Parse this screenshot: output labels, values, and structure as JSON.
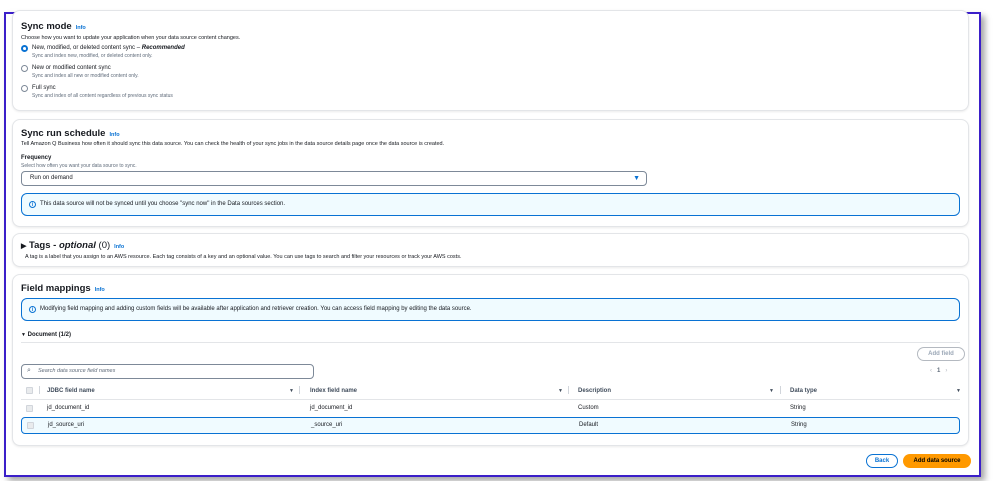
{
  "sync_mode": {
    "title": "Sync mode",
    "info": "Info",
    "description": "Choose how you want to update your application when your data source content changes.",
    "options": [
      {
        "label": "New, modified, or deleted content sync",
        "suffix": "Recommended",
        "description": "Sync and index new, modified, or deleted content only.",
        "selected": true
      },
      {
        "label": "New or modified content sync",
        "description": "Sync and index all new or modified content only.",
        "selected": false
      },
      {
        "label": "Full sync",
        "description": "Sync and index of all content regardless of previous sync status",
        "selected": false
      }
    ]
  },
  "schedule": {
    "title": "Sync run schedule",
    "info": "Info",
    "description": "Tell Amazon Q Business how often it should sync this data source. You can check the health of your sync jobs in the data source details page once the data source is created.",
    "frequency_label": "Frequency",
    "frequency_hint": "Select how often you want your data source to sync.",
    "frequency_value": "Run on demand",
    "alert": "This data source will not be synced until you choose \"sync now\" in the Data sources section."
  },
  "tags": {
    "title": "Tags -",
    "optional": "optional",
    "count": "(0)",
    "info": "Info",
    "description": "A tag is a label that you assign to an AWS resource. Each tag consists of a key and an optional value. You can use tags to search and filter your resources or track your AWS costs."
  },
  "field_mappings": {
    "title": "Field mappings",
    "info": "Info",
    "alert": "Modifying field mapping and adding custom fields will be available after application and retriever creation. You can access field mapping by editing the data source.",
    "section": "Document (1/2)",
    "add_field": "Add field",
    "search_placeholder": "Search data source field names",
    "page": "1",
    "columns": [
      "JDBC field name",
      "Index field name",
      "Description",
      "Data type"
    ],
    "rows": [
      [
        "jd_document_id",
        "jd_document_id",
        "Custom",
        "String"
      ],
      [
        "jd_source_uri",
        "_source_uri",
        "Default",
        "String"
      ]
    ]
  },
  "footer": {
    "back": "Back",
    "add": "Add data source"
  }
}
